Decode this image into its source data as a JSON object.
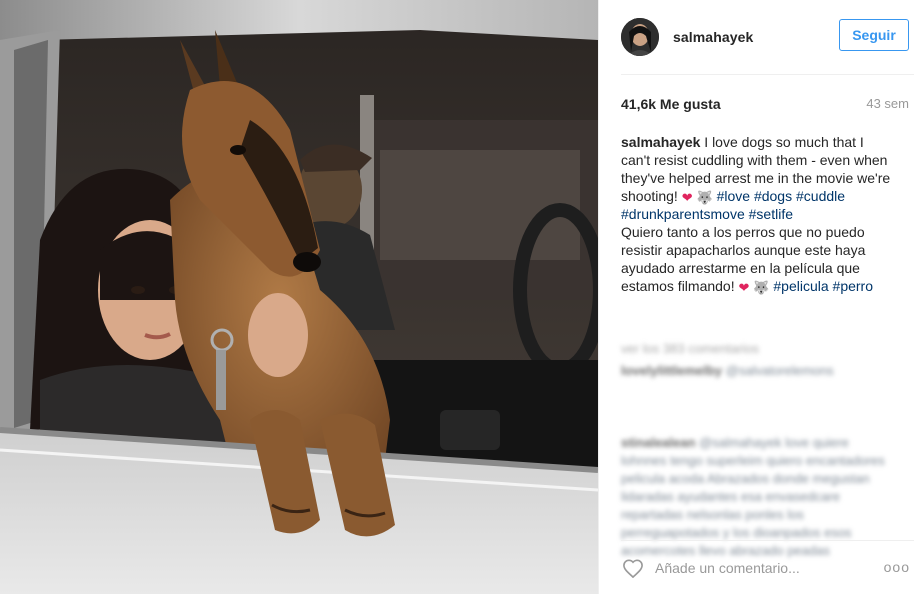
{
  "post": {
    "photo_icon": "dog-and-woman-in-car-photo"
  },
  "header": {
    "username": "salmahayek",
    "follow_label": "Seguir",
    "avatar_icon": "avatar-icon"
  },
  "stats": {
    "likes": "41,6k Me gusta",
    "time": "43 sem"
  },
  "caption": {
    "username": "salmahayek",
    "text_en": " I love dogs so much that I can't resist cuddling with them - even when they've helped arrest me in the movie we're shooting! ",
    "emoji_heart": "❤",
    "emoji_wolf": "🐺",
    "tags_en": [
      "#love",
      "#dogs",
      "#cuddle",
      "#drunkparentsmove",
      "#setlife"
    ],
    "text_es": "Quiero tanto a los perros que no puedo resistir apapacharlos aunque este haya ayudado arrestarme en la película que estamos filmando! ",
    "tags_es": [
      "#pelicula",
      "#perro"
    ]
  },
  "comments": {
    "view_all": "ver los 383 comentarios",
    "items": [
      {
        "user": "lovelylittlemelby",
        "text": "@salvatorelemons"
      },
      {
        "user": "stinalealean",
        "text": "@salmahayek love quiere lohnnes tengo superleim quiero encantadores pelicula acoda Abrazados donde megustan lidaradas ayudantes esa envasedcare repartadas nelsonlas ponles los perreguapotados y los dioanpados esos acomercotes llevo abrazado peadas"
      }
    ]
  },
  "footer": {
    "comment_placeholder": "Añade un comentario...",
    "more_label": "ooo",
    "heart_icon": "heart-outline-icon",
    "more_icon": "more-options-icon"
  },
  "colors": {
    "accent": "#3897f0",
    "hashtag": "#003569",
    "muted": "#999999",
    "heart": "#e0245e"
  }
}
